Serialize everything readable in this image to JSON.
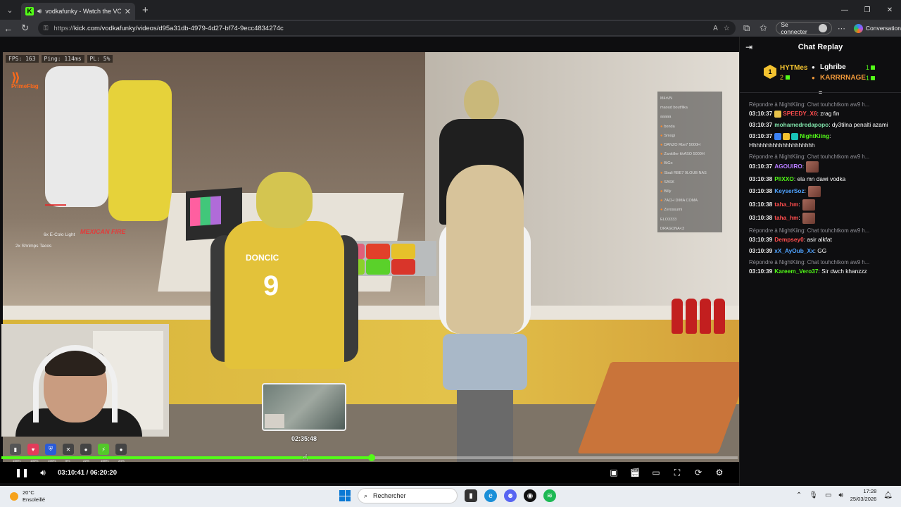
{
  "browser": {
    "tab_title": "vodkafunky - Watch the VOD",
    "url_prefix": "https://",
    "url": "kick.com/vodkafunky/videos/d95a31db-4979-4d27-bf74-9ecc4834274c",
    "signin_label": "Se connecter",
    "conversation_label": "Conversation"
  },
  "game_hud": {
    "fps": "FPS: 163",
    "ping": "Ping: 114ms",
    "pl": "PL: 5%",
    "prime_label": "PrimeFlag",
    "mexican_label": "MEXICAN FIRE",
    "inventory": [
      "6x E-Colo Light",
      "2x Shrimps Tacos"
    ],
    "player_list": [
      "M4rVN",
      "maoud boutflika",
      "aaaaa",
      "bonda",
      "Smogi",
      "DANZO Rbe7 5000H",
      "Zankiller khASO 5000H",
      "BiGo",
      "Sbali RBE7 9LOUB NAS",
      "SASK",
      "Billy",
      "7ACH DIMA COMA",
      "Zerossumi",
      "ELO3333",
      "DRAGONA<3"
    ],
    "player_list_active": [
      false,
      false,
      false,
      true,
      true,
      true,
      true,
      true,
      true,
      true,
      true,
      true,
      true,
      false,
      false
    ],
    "hud_pcts": [
      "100%",
      "100%",
      "100%",
      "8%",
      "22%",
      "100%",
      "24%"
    ]
  },
  "jersey": {
    "name": "DONCIC",
    "number": "9"
  },
  "player": {
    "preview_time": "02:35:48",
    "current_time": "03:10:41",
    "separator": " / ",
    "duration": "06:20:20",
    "progress_fraction": 0.503,
    "hover_fraction": 0.41
  },
  "chat": {
    "title": "Chat Replay",
    "leaderboard": [
      {
        "rank": "1",
        "user": "HYTMes",
        "count": "2"
      },
      {
        "user": "Lghribe",
        "count": "1"
      },
      {
        "user": "KARRRNAGE",
        "count": "1"
      }
    ],
    "messages": [
      {
        "reply": "Répondre à NightKiing: Chat touhchtkom aw9 h...",
        "ts": "03:10:37",
        "user": "SPEEDY_X6",
        "color": "#ff4d4d",
        "text": " zrag fin",
        "badges": [
          "emote"
        ]
      },
      {
        "reply": "",
        "ts": "03:10:37",
        "user": "mohamedredapopo",
        "color": "#7ee0a8",
        "text": " dy3tilna penalti azami",
        "badges": []
      },
      {
        "reply": "",
        "ts": "03:10:37",
        "user": "NightKiing",
        "color": "#53fc18",
        "text": " Hhhhhhhhhhhhhhhhhhhh",
        "badges": [
          "blue",
          "gold",
          "teal"
        ]
      },
      {
        "reply": "Répondre à NightKiing: Chat touhchtkom aw9 h...",
        "ts": "03:10:37",
        "user": "AGOUIRO",
        "color": "#b57bff",
        "text": "",
        "badges": [],
        "emote": true
      },
      {
        "reply": "",
        "ts": "03:10:38",
        "user": "PllXXO",
        "color": "#53fc18",
        "text": " ela mn dawi vodka",
        "badges": []
      },
      {
        "reply": "",
        "ts": "03:10:38",
        "user": "KeyserSoz",
        "color": "#4fa3ff",
        "text": "",
        "badges": [],
        "emote": true
      },
      {
        "reply": "",
        "ts": "03:10:38",
        "user": "taha_hm",
        "color": "#ff4d4d",
        "text": "",
        "badges": [],
        "emote": true
      },
      {
        "reply": "",
        "ts": "03:10:38",
        "user": "taha_hm",
        "color": "#ff4d4d",
        "text": "",
        "badges": [],
        "emote": true
      },
      {
        "reply": "Répondre à NightKiing: Chat touhchtkom aw9 h...",
        "ts": "03:10:39",
        "user": "Dempsey0",
        "color": "#ff4d4d",
        "text": " asir alkfat",
        "badges": []
      },
      {
        "reply": "",
        "ts": "03:10:39",
        "user": "xX_AyOub_Xx",
        "color": "#4fa3ff",
        "text": " GG",
        "badges": []
      },
      {
        "reply": "Répondre à NightKiing: Chat touhchtkom aw9 h...",
        "ts": "03:10:39",
        "user": "Kareem_Vero37",
        "color": "#53fc18",
        "text": " Sir dwch khanzzz",
        "badges": []
      }
    ]
  },
  "taskbar": {
    "temp": "20°C",
    "weather": "Ensoleillé",
    "search_placeholder": "Rechercher",
    "time": "17:28",
    "date": "25/03/2026"
  },
  "colors": {
    "kick_green": "#53fc18",
    "chat_bg": "#0e0e10"
  }
}
